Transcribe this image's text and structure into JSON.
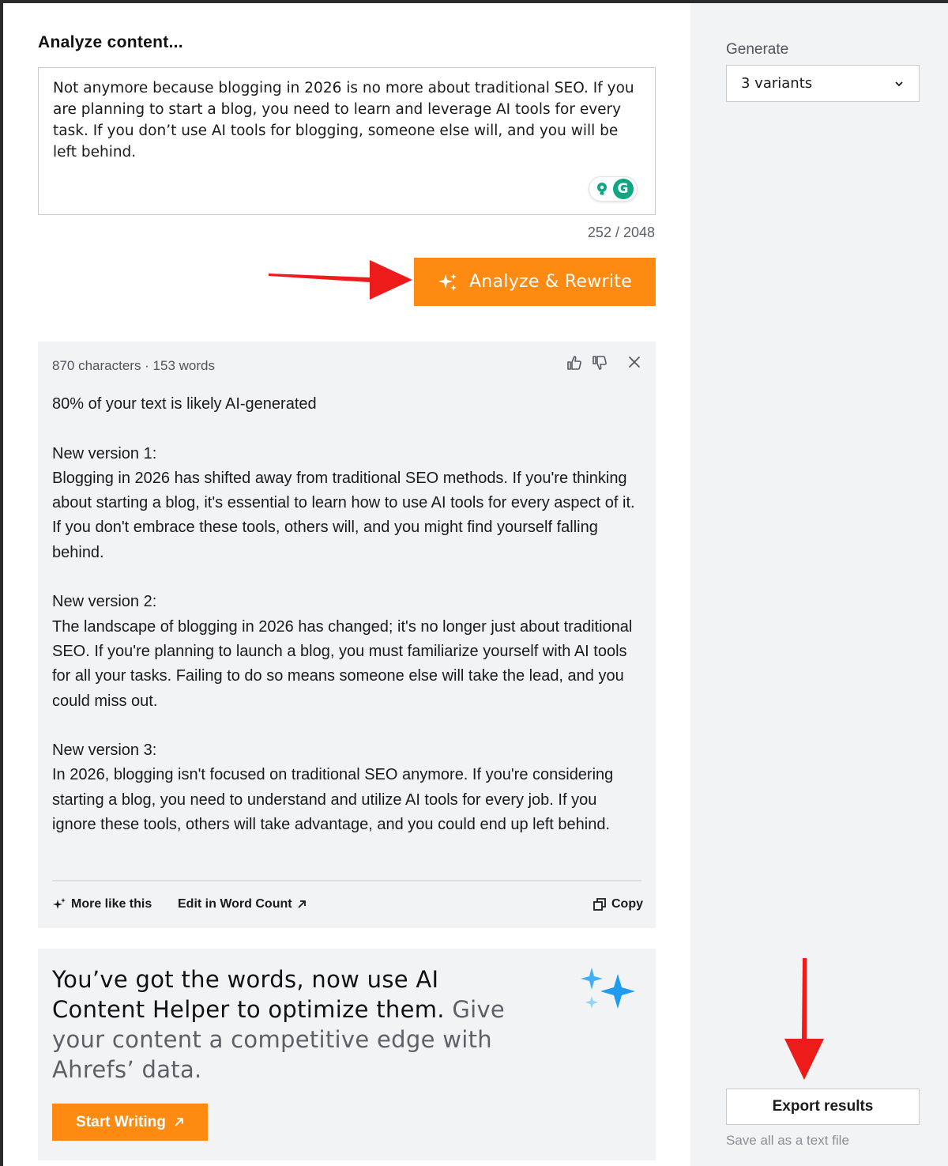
{
  "main": {
    "section_title": "Analyze content...",
    "input": {
      "value": "Not anymore because blogging in 2026 is no more about traditional SEO. If you are planning to start a blog, you need to learn and leverage AI tools for every task. If you don’t use AI tools for blogging, someone else will, and you will be left behind.",
      "char_count": "252 / 2048"
    },
    "analyze_button": "Analyze & Rewrite"
  },
  "result": {
    "meta": "870 characters · 153 words",
    "body": "80% of your text is likely AI-generated\n\nNew version 1:\nBlogging in 2026 has shifted away from traditional SEO methods. If you're thinking about starting a blog, it's essential to learn how to use AI tools for every aspect of it. If you don't embrace these tools, others will, and you might find yourself falling behind.\n\nNew version 2:\nThe landscape of blogging in 2026 has changed; it's no longer just about traditional SEO. If you're planning to launch a blog, you must familiarize yourself with AI tools for all your tasks. Failing to do so means someone else will take the lead, and you could miss out.\n\nNew version 3:\nIn 2026, blogging isn't focused on traditional SEO anymore. If you're considering starting a blog, you need to understand and utilize AI tools for every job. If you ignore these tools, others will take advantage, and you could end up left behind.",
    "actions": {
      "more_like_this": "More like this",
      "edit_word_count": "Edit in Word Count",
      "copy": "Copy"
    }
  },
  "promo": {
    "headline_strong": "You’ve got the words, now use AI Content Helper to optimize them.",
    "headline_muted": " Give your content a competitive edge with Ahrefs’ data.",
    "button": "Start Writing"
  },
  "sidebar": {
    "generate_label": "Generate",
    "variants_selected": "3 variants",
    "export_button": "Export results",
    "export_caption": "Save all as a text file"
  },
  "colors": {
    "accent_orange": "#ff8a12",
    "annotation_red": "#ee1b1b",
    "panel_gray": "#f2f3f5",
    "grammarly_green": "#11a683"
  },
  "icons": [
    "sparkle-icon",
    "thumbs-up-icon",
    "thumbs-down-icon",
    "close-icon",
    "external-arrow-icon",
    "copy-icon",
    "chevron-down-icon",
    "grammarly-icon",
    "lightbulb-icon"
  ]
}
